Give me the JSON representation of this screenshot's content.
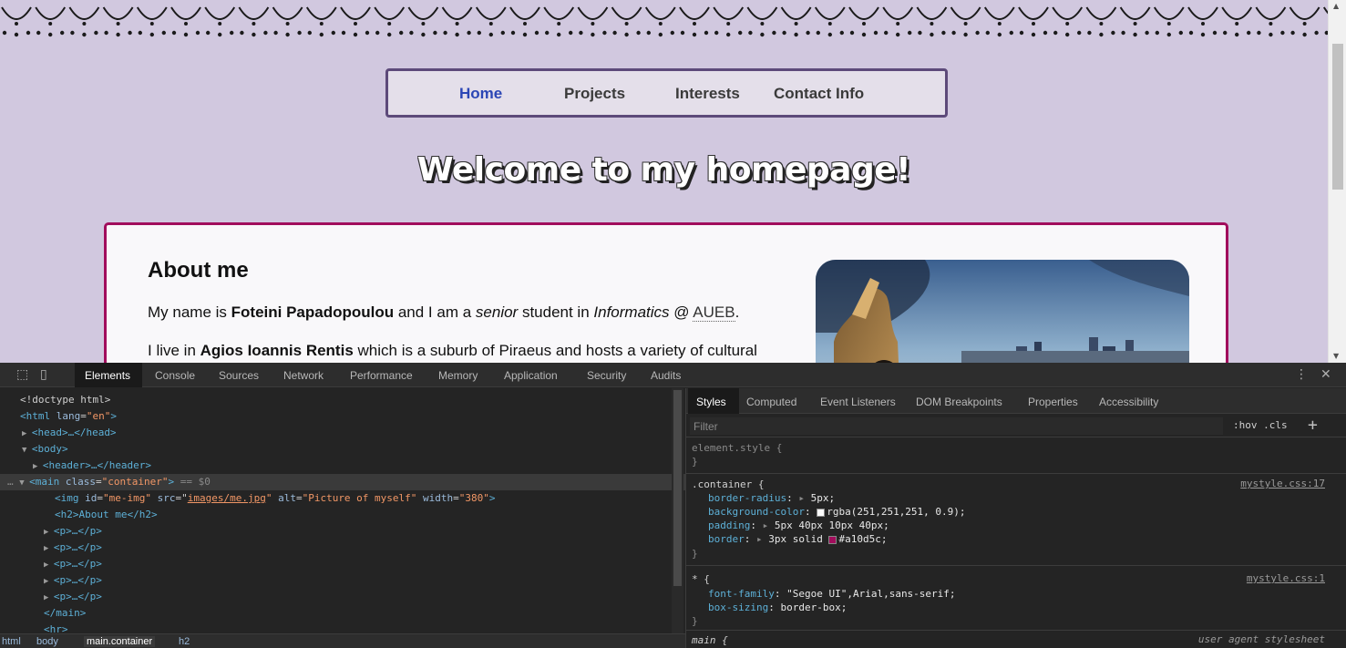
{
  "nav": {
    "items": [
      "Home",
      "Projects",
      "Interests",
      "Contact Info"
    ]
  },
  "page": {
    "heading": "Welcome to my homepage!",
    "about_heading": "About me",
    "p1": {
      "pre": "My name is ",
      "name": "Foteini Papadopoulou",
      "mid": " and I am a ",
      "senior": "senior",
      "mid2": " student in ",
      "field": "Informatics",
      "at": " @ ",
      "uni": "AUEB",
      "end": "."
    },
    "p2": {
      "pre": "I live in ",
      "place": "Agios Ioannis Rentis",
      "rest": " which is a suburb of Piraeus and hosts a variety of cultural"
    },
    "image_alt": "Picture of myself"
  },
  "devtools": {
    "tabs": [
      "Elements",
      "Console",
      "Sources",
      "Network",
      "Performance",
      "Memory",
      "Application",
      "Security",
      "Audits"
    ],
    "dom": {
      "doctype": "<!doctype html>",
      "html_open": "<html",
      "lang_attr": "lang",
      "lang_val": "\"en\"",
      "head": "<head>…</head>",
      "body_open": "<body>",
      "header": "<header>…</header>",
      "main_tag": "<main",
      "class_attr": "class",
      "class_val": "\"container\"",
      "dollar0": "== $0",
      "img_tag": "<img",
      "img_id_attr": "id",
      "img_id_val": "\"me-img\"",
      "img_src_attr": "src",
      "img_src_val": "images/me.jpg",
      "img_alt_attr": "alt",
      "img_alt_val": "\"Picture of myself\"",
      "img_width_attr": "width",
      "img_width_val": "\"380\"",
      "h2": "<h2>About me</h2>",
      "p": "<p>…</p>",
      "main_close": "</main>",
      "hr": "<hr>"
    },
    "breadcrumbs": [
      "html",
      "body",
      "main.container",
      "h2"
    ],
    "styles": {
      "tabs": [
        "Styles",
        "Computed",
        "Event Listeners",
        "DOM Breakpoints",
        "Properties",
        "Accessibility"
      ],
      "filter_placeholder": "Filter",
      "hov_cls": ":hov  .cls",
      "element_style": "element.style {",
      "close_brace": "}",
      "container_selector": ".container {",
      "container_src": "mystyle.css:17",
      "border_radius": "border-radius",
      "border_radius_val": "5px;",
      "bg_color": "background-color",
      "bg_color_val": "rgba(251,251,251, 0.9);",
      "padding": "padding",
      "padding_val": "5px 40px 10px 40px;",
      "border": "border",
      "border_val": "3px solid ",
      "border_color_val": "#a10d5c;",
      "star_selector": "* {",
      "star_src": "mystyle.css:1",
      "font_family": "font-family",
      "font_family_val": "\"Segoe UI\",Arial,sans-serif;",
      "box_sizing": "box-sizing",
      "box_sizing_val": "border-box;",
      "main_selector": "main {",
      "main_src": "user agent stylesheet"
    },
    "colors": {
      "bg_swatch": "#fbfbfb",
      "border_swatch": "#a10d5c"
    }
  }
}
